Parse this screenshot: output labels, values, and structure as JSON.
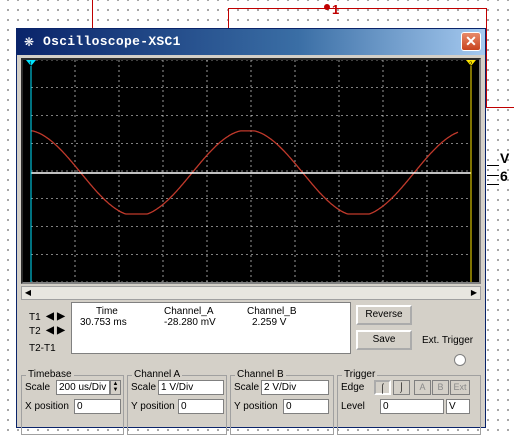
{
  "background": {
    "wire_node_label": "1",
    "right_label_top": "V",
    "right_label_bottom": "6",
    "wire_color": "#c00000"
  },
  "window": {
    "title": "Oscilloscope-XSC1",
    "close_glyph": "✕",
    "icon": "oscilloscope-icon"
  },
  "screen": {
    "background": "#000000",
    "grid_color": "#ffffff",
    "channel_a_color": "#c0392b",
    "channel_b_color": "#ffffff",
    "marker_t1": "1",
    "marker_t2": "2"
  },
  "readout": {
    "t1_label": "T1",
    "t2_label": "T2",
    "t2t1_label": "T2-T1",
    "headers": {
      "time": "Time",
      "channel_a": "Channel_A",
      "channel_b": "Channel_B"
    },
    "row": {
      "time": "30.753 ms",
      "channel_a": "-28.280 mV",
      "channel_b": "2.259 V"
    },
    "reverse_label": "Reverse",
    "save_label": "Save",
    "ext_trigger_label": "Ext. Trigger"
  },
  "timebase": {
    "title": "Timebase",
    "scale_label": "Scale",
    "scale_value": "200 us/Div",
    "xpos_label": "X position",
    "xpos_value": "0"
  },
  "channel_a": {
    "title": "Channel A",
    "scale_label": "Scale",
    "scale_value": "1  V/Div",
    "ypos_label": "Y position",
    "ypos_value": "0"
  },
  "channel_b": {
    "title": "Channel B",
    "scale_label": "Scale",
    "scale_value": "2  V/Div",
    "ypos_label": "Y position",
    "ypos_value": "0"
  },
  "trigger": {
    "title": "Trigger",
    "edge_label": "Edge",
    "edge_buttons": [
      "rising-edge-icon",
      "falling-edge-icon"
    ],
    "source_buttons": [
      "A",
      "B",
      "Ext"
    ],
    "level_label": "Level",
    "level_value": "0",
    "level_unit": "V"
  }
}
